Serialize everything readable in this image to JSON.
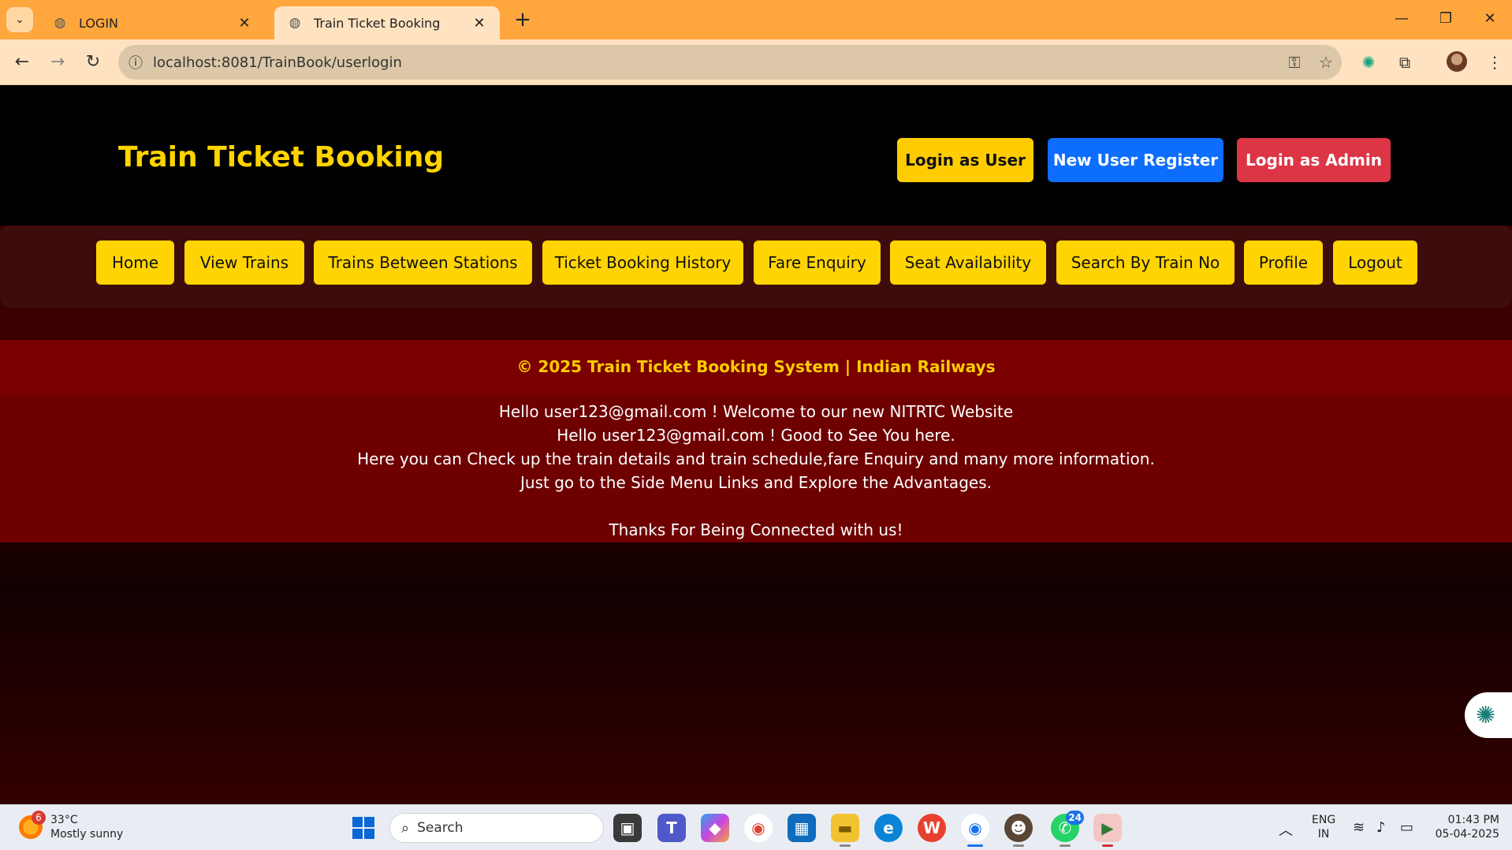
{
  "browser": {
    "tabs": [
      {
        "title": "LOGIN",
        "active": false
      },
      {
        "title": "Train Ticket Booking",
        "active": true
      }
    ],
    "url": "localhost:8081/TrainBook/userlogin"
  },
  "site": {
    "brand": "Train Ticket Booking",
    "header_buttons": {
      "login_user": "Login as User",
      "register": "New User Register",
      "login_admin": "Login as Admin"
    },
    "menu": [
      "Home",
      "View Trains",
      "Trains Between Stations",
      "Ticket Booking History",
      "Fare Enquiry",
      "Seat Availability",
      "Search By Train No",
      "Profile",
      "Logout"
    ],
    "footer": "© 2025 Train Ticket Booking System | Indian Railways",
    "welcome_lines": [
      "Hello user123@gmail.com ! Welcome to our new NITRTC Website",
      "Hello user123@gmail.com ! Good to See You here.",
      "Here you can Check up the train details and train schedule,fare Enquiry and many more information.",
      "Just go to the Side Menu Links and Explore the Advantages."
    ],
    "thanks": "Thanks For Being Connected with us!"
  },
  "taskbar": {
    "weather_temp": "33°C",
    "weather_desc": "Mostly sunny",
    "weather_badge": "6",
    "search_placeholder": "Search",
    "whatsapp_badge": "24",
    "lang": "ENG",
    "region": "IN",
    "time": "01:43 PM",
    "date": "05-04-2025"
  },
  "colors": {
    "tabbar": "#ffa63d",
    "brand_yellow": "#ffd400",
    "register_blue": "#0d6efd",
    "admin_red": "#dc3545",
    "footer_maroon": "#7a0000"
  }
}
